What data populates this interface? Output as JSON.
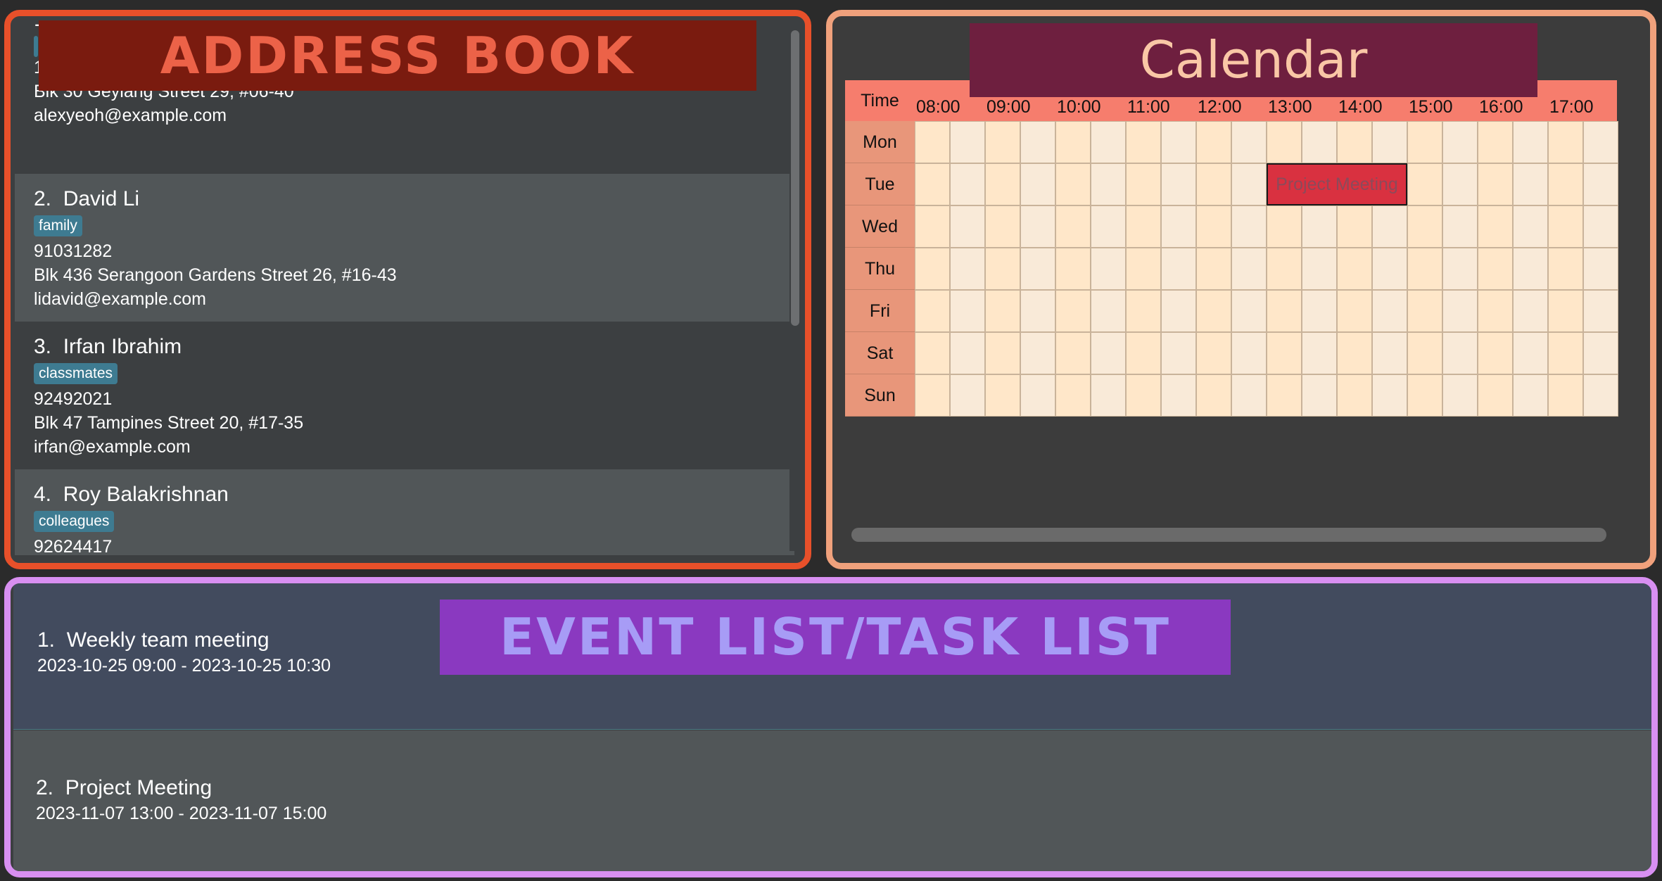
{
  "address_book": {
    "banner": "ADDRESS BOOK",
    "persons": [
      {
        "index": "1.",
        "name": "",
        "tag": "",
        "phone": "12345678",
        "address": "Blk 30 Geylang Street 29, #06-40",
        "email": "alexyeoh@example.com"
      },
      {
        "index": "2.",
        "name": "David Li",
        "tag": "family",
        "phone": "91031282",
        "address": "Blk 436 Serangoon Gardens Street 26, #16-43",
        "email": "lidavid@example.com"
      },
      {
        "index": "3.",
        "name": "Irfan Ibrahim",
        "tag": "classmates",
        "phone": "92492021",
        "address": "Blk 47 Tampines Street 20, #17-35",
        "email": "irfan@example.com"
      },
      {
        "index": "4.",
        "name": "Roy Balakrishnan",
        "tag": "colleagues",
        "phone": "92624417",
        "address": "",
        "email": ""
      }
    ]
  },
  "calendar": {
    "banner": "Calendar",
    "corner_label": "Time",
    "times": [
      "08:00",
      "09:00",
      "10:00",
      "11:00",
      "12:00",
      "13:00",
      "14:00",
      "15:00",
      "16:00",
      "17:00"
    ],
    "days": [
      "Mon",
      "Tue",
      "Wed",
      "Thu",
      "Fri",
      "Sat",
      "Sun"
    ],
    "events": [
      {
        "title": "Project Meeting",
        "day": "Tue",
        "start": "13:00",
        "end": "15:00",
        "color": "#d93140"
      }
    ]
  },
  "event_list": {
    "banner": "EVENT LIST/TASK LIST",
    "events": [
      {
        "index": "1.",
        "title": "Weekly team meeting",
        "time": "2023-10-25 09:00 - 2023-10-25 10:30"
      },
      {
        "index": "2.",
        "title": "Project Meeting",
        "time": "2023-11-07 13:00 - 2023-11-07 15:00"
      }
    ]
  },
  "colors": {
    "address_book_border": "#e8502a",
    "calendar_border": "#f0a17c",
    "event_list_border": "#d88ff1",
    "tag_background": "#3e7b91",
    "calendar_header": "#f67d6d",
    "calendar_day_column": "#e8967a"
  }
}
